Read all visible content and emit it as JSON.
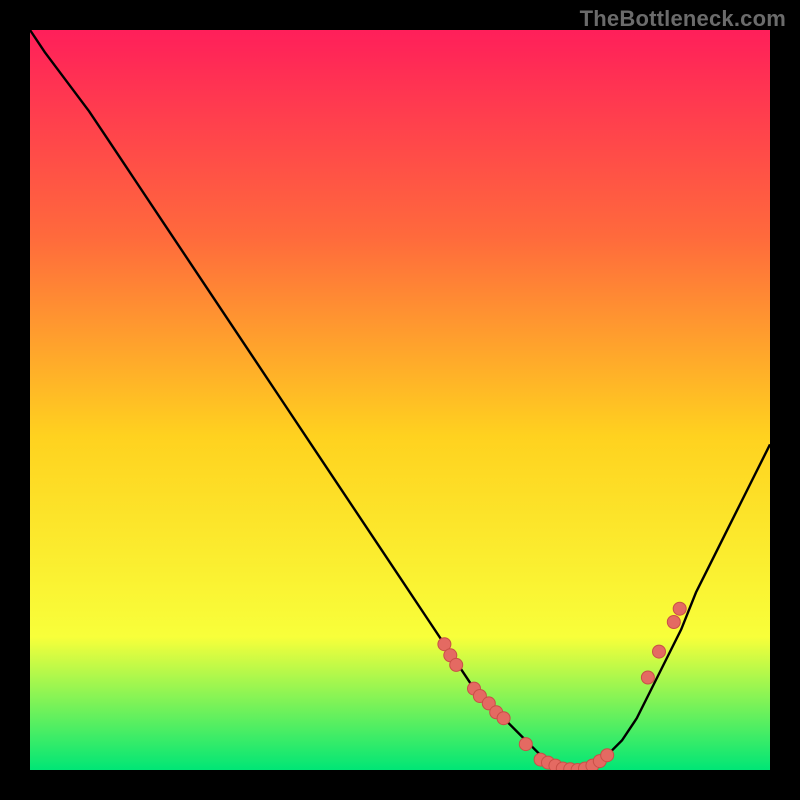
{
  "watermark": "TheBottleneck.com",
  "colors": {
    "frame": "#000000",
    "curve": "#000000",
    "dot_fill": "#e46a62",
    "dot_stroke": "#c94f47",
    "gradient_top": "#ff1f5a",
    "gradient_upper": "#ff6a3c",
    "gradient_mid": "#ffd21f",
    "gradient_low": "#f8ff3a",
    "gradient_bottom": "#00e676"
  },
  "chart_data": {
    "type": "line",
    "title": "",
    "xlabel": "",
    "ylabel": "",
    "xlim": [
      0,
      100
    ],
    "ylim": [
      0,
      100
    ],
    "x": [
      0,
      2,
      5,
      8,
      10,
      14,
      18,
      22,
      26,
      30,
      34,
      38,
      42,
      46,
      50,
      54,
      56,
      58,
      60,
      62,
      64,
      66,
      68,
      70,
      72,
      74,
      76,
      78,
      80,
      82,
      84,
      86,
      88,
      90,
      92,
      94,
      96,
      98,
      100
    ],
    "values": [
      100,
      97,
      93,
      89,
      86,
      80,
      74,
      68,
      62,
      56,
      50,
      44,
      38,
      32,
      26,
      20,
      17,
      14,
      11,
      9,
      7,
      5,
      3,
      1,
      0,
      0,
      1,
      2,
      4,
      7,
      11,
      15,
      19,
      24,
      28,
      32,
      36,
      40,
      44
    ],
    "markers_left": [
      {
        "x": 56,
        "y": 17
      },
      {
        "x": 56.8,
        "y": 15.5
      },
      {
        "x": 57.6,
        "y": 14.2
      },
      {
        "x": 60,
        "y": 11
      },
      {
        "x": 60.8,
        "y": 10
      },
      {
        "x": 62,
        "y": 9
      },
      {
        "x": 63,
        "y": 7.8
      },
      {
        "x": 64,
        "y": 7
      }
    ],
    "markers_bottom": [
      {
        "x": 67,
        "y": 3.5
      },
      {
        "x": 69,
        "y": 1.4
      },
      {
        "x": 70,
        "y": 1
      },
      {
        "x": 71,
        "y": 0.6
      },
      {
        "x": 72,
        "y": 0.2
      },
      {
        "x": 73,
        "y": 0.1
      },
      {
        "x": 74,
        "y": 0
      },
      {
        "x": 75,
        "y": 0.2
      },
      {
        "x": 76,
        "y": 0.6
      },
      {
        "x": 77,
        "y": 1.2
      },
      {
        "x": 78,
        "y": 2
      }
    ],
    "markers_right": [
      {
        "x": 83.5,
        "y": 12.5
      },
      {
        "x": 85,
        "y": 16
      },
      {
        "x": 87,
        "y": 20
      },
      {
        "x": 87.8,
        "y": 21.8
      }
    ]
  }
}
